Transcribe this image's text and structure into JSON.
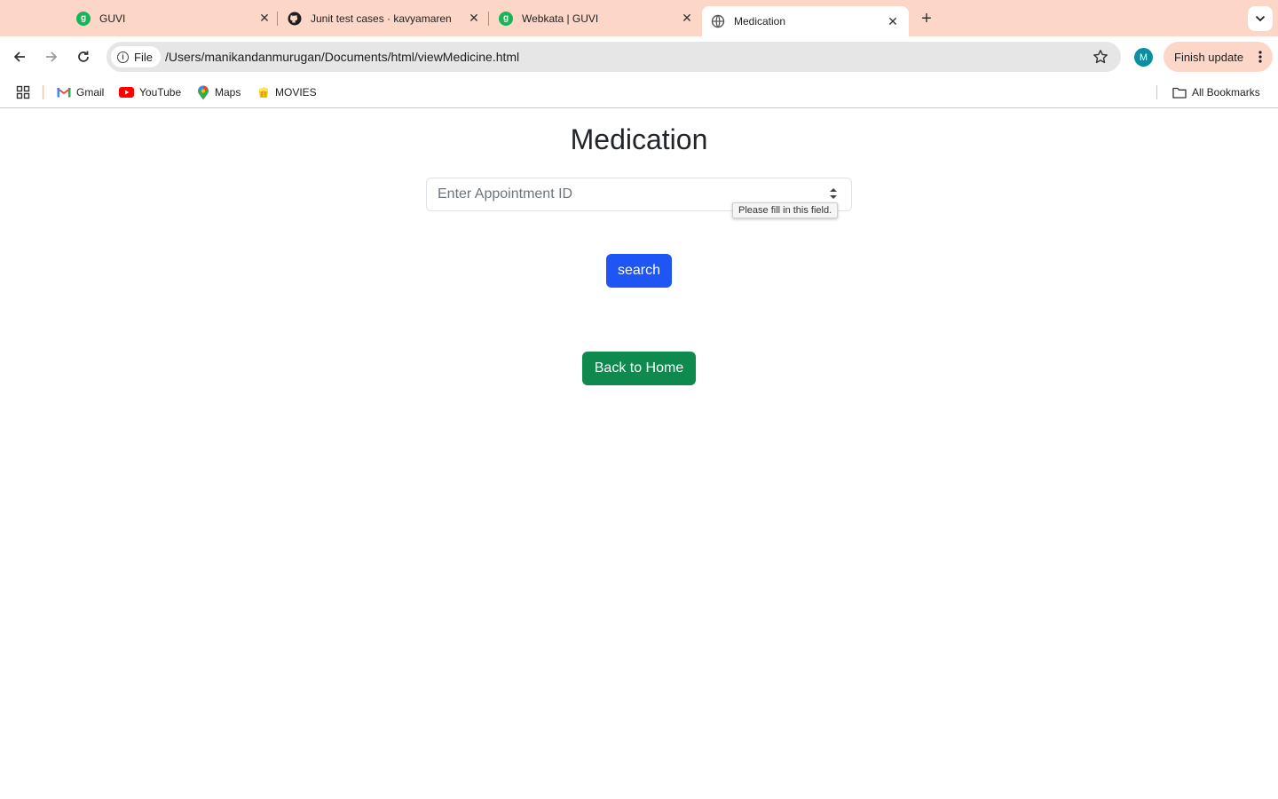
{
  "browser": {
    "tabs": [
      {
        "title": "GUVI",
        "favicon": "guvi-icon",
        "active": false
      },
      {
        "title": "Junit test cases · kavyamaren",
        "favicon": "github-icon",
        "active": false
      },
      {
        "title": "Webkata | GUVI",
        "favicon": "guvi-icon",
        "active": false
      },
      {
        "title": "Medication",
        "favicon": "globe-icon",
        "active": true
      }
    ],
    "guvi_favicon_letter": "g",
    "chip_label": "File",
    "url": "/Users/manikandanmurugan/Documents/html/viewMedicine.html",
    "profile_initial": "M",
    "update_button": "Finish update",
    "bookmarks": [
      {
        "label": "Gmail",
        "icon": "gmail-icon"
      },
      {
        "label": "YouTube",
        "icon": "youtube-icon"
      },
      {
        "label": "Maps",
        "icon": "maps-icon"
      },
      {
        "label": "MOVIES",
        "icon": "movies-icon"
      }
    ],
    "all_bookmarks": "All Bookmarks",
    "colors": {
      "tabstrip": "#fcd7c7",
      "omnibox": "#e6e6e6"
    }
  },
  "page": {
    "title": "Medication",
    "appointment_input": {
      "placeholder": "Enter Appointment ID",
      "value": ""
    },
    "validation_tooltip": "Please fill in this field.",
    "search_button": "search",
    "back_button": "Back to Home",
    "colors": {
      "search_button": "#1f55f5",
      "back_button": "#0f8a4e"
    }
  }
}
